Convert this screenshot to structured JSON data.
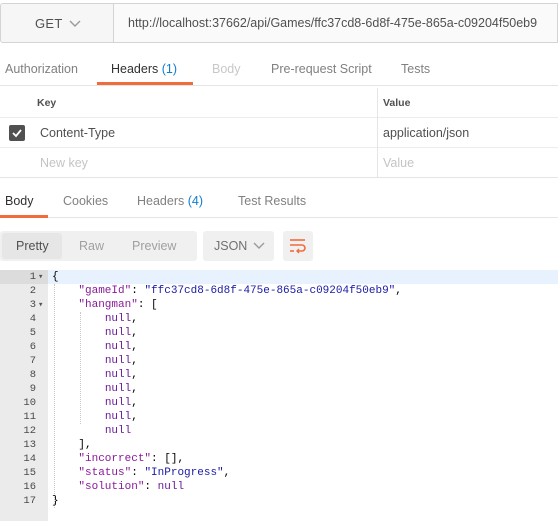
{
  "request": {
    "method": "GET",
    "url": "http://localhost:37662/api/Games/ffc37cd8-6d8f-475e-865a-c09204f50eb9"
  },
  "request_tabs": [
    {
      "label": "Authorization",
      "count": ""
    },
    {
      "label": "Headers",
      "count": "(1)"
    },
    {
      "label": "Body",
      "count": ""
    },
    {
      "label": "Pre-request Script",
      "count": ""
    },
    {
      "label": "Tests",
      "count": ""
    }
  ],
  "headers_table": {
    "col_key": "Key",
    "col_value": "Value",
    "rows": [
      {
        "key": "Content-Type",
        "value": "application/json",
        "checked": true
      }
    ],
    "new_key_placeholder": "New key",
    "new_value_placeholder": "Value"
  },
  "response_tabs": [
    {
      "label": "Body",
      "count": ""
    },
    {
      "label": "Cookies",
      "count": ""
    },
    {
      "label": "Headers",
      "count": "(4)"
    },
    {
      "label": "Test Results",
      "count": ""
    }
  ],
  "view_modes": [
    "Pretty",
    "Raw",
    "Preview"
  ],
  "format": "JSON",
  "code_lines": [
    {
      "n": "1",
      "text": "{"
    },
    {
      "n": "2",
      "text": "    \"gameId\": \"ffc37cd8-6d8f-475e-865a-c09204f50eb9\","
    },
    {
      "n": "3",
      "text": "    \"hangman\": ["
    },
    {
      "n": "4",
      "text": "        null,"
    },
    {
      "n": "5",
      "text": "        null,"
    },
    {
      "n": "6",
      "text": "        null,"
    },
    {
      "n": "7",
      "text": "        null,"
    },
    {
      "n": "8",
      "text": "        null,"
    },
    {
      "n": "9",
      "text": "        null,"
    },
    {
      "n": "10",
      "text": "        null,"
    },
    {
      "n": "11",
      "text": "        null,"
    },
    {
      "n": "12",
      "text": "        null"
    },
    {
      "n": "13",
      "text": "    ],"
    },
    {
      "n": "14",
      "text": "    \"incorrect\": [],"
    },
    {
      "n": "15",
      "text": "    \"status\": \"InProgress\","
    },
    {
      "n": "16",
      "text": "    \"solution\": null"
    },
    {
      "n": "17",
      "text": "}"
    }
  ],
  "colors": {
    "accent": "#f26b3a",
    "count": "#0f7dd0"
  }
}
